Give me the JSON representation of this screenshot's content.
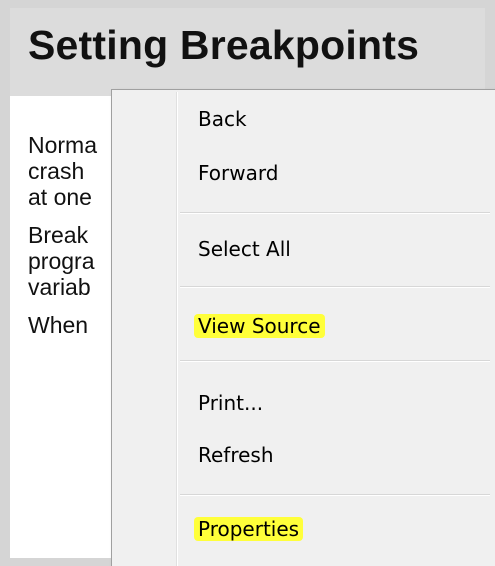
{
  "page": {
    "title": "Setting Breakpoints",
    "paragraphs": [
      [
        "Norma",
        "crash",
        "at one"
      ],
      [
        "Break",
        "progra",
        "variab"
      ],
      [
        "When"
      ]
    ]
  },
  "context_menu": {
    "items": [
      {
        "label": "Back",
        "highlighted": false
      },
      {
        "label": "Forward",
        "highlighted": false
      },
      {
        "label": "Select All",
        "highlighted": false
      },
      {
        "label": "View Source",
        "highlighted": true
      },
      {
        "label": "Print...",
        "highlighted": false
      },
      {
        "label": "Refresh",
        "highlighted": false
      },
      {
        "label": "Properties",
        "highlighted": true
      }
    ],
    "highlight_color": "#ffff3a"
  }
}
